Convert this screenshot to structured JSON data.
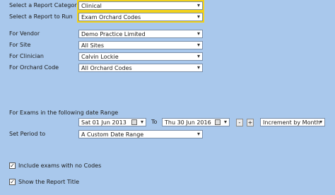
{
  "category": {
    "label": "Select a Report Category",
    "value": "Clinical"
  },
  "report": {
    "label": "Select a Report to Run",
    "value": "Exam Orchard Codes"
  },
  "vendor": {
    "label": "For Vendor",
    "value": "Demo Practice Limited"
  },
  "site": {
    "label": "For Site",
    "value": "All Sites"
  },
  "clinician": {
    "label": "For Clinician",
    "value": "Calvin Lockie"
  },
  "orchard_code": {
    "label": "For Orchard Code",
    "value": "All Orchard Codes"
  },
  "date_range": {
    "label": "For Exams in the following date Range",
    "from": "Sat  01 Jun  2013",
    "to_label": "To",
    "to": "Thu 30 Jun  2016",
    "minus": "-",
    "plus": "+",
    "increment": "Increment by Month"
  },
  "period": {
    "label": "Set Period to",
    "value": "A Custom Date Range"
  },
  "options": {
    "include_no_codes": {
      "label": "Include exams with no Codes",
      "checked": "✓"
    },
    "show_title": {
      "label": "Show the Report Title",
      "checked": "✓"
    }
  },
  "icons": {
    "dropdown": "▾",
    "calendar": "calendar-icon"
  }
}
